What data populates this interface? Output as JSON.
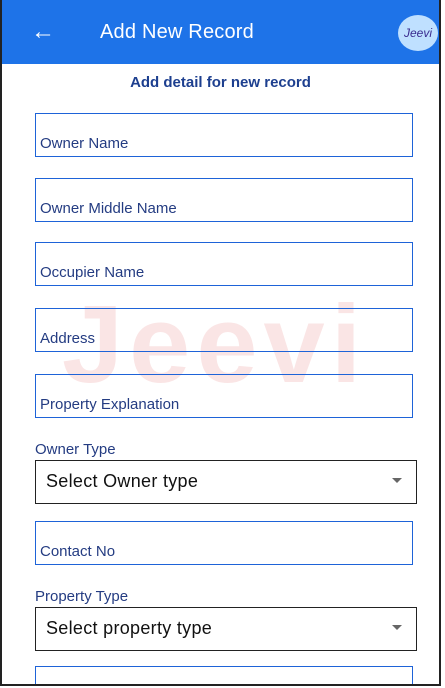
{
  "appbar": {
    "title": "Add New Record",
    "back_icon": "←",
    "logo_text": "Jeevi"
  },
  "watermark_text": "Jeevi",
  "form": {
    "subtitle": "Add detail for new record",
    "fields": {
      "owner_name": "Owner Name",
      "owner_middle_name": "Owner Middle Name",
      "occupier_name": "Occupier Name",
      "address": "Address",
      "property_explanation": "Property Explanation",
      "contact_no": "Contact No"
    },
    "owner_type": {
      "label": "Owner Type",
      "placeholder": "Select Owner type"
    },
    "property_type": {
      "label": "Property Type",
      "placeholder": "Select property type"
    }
  }
}
